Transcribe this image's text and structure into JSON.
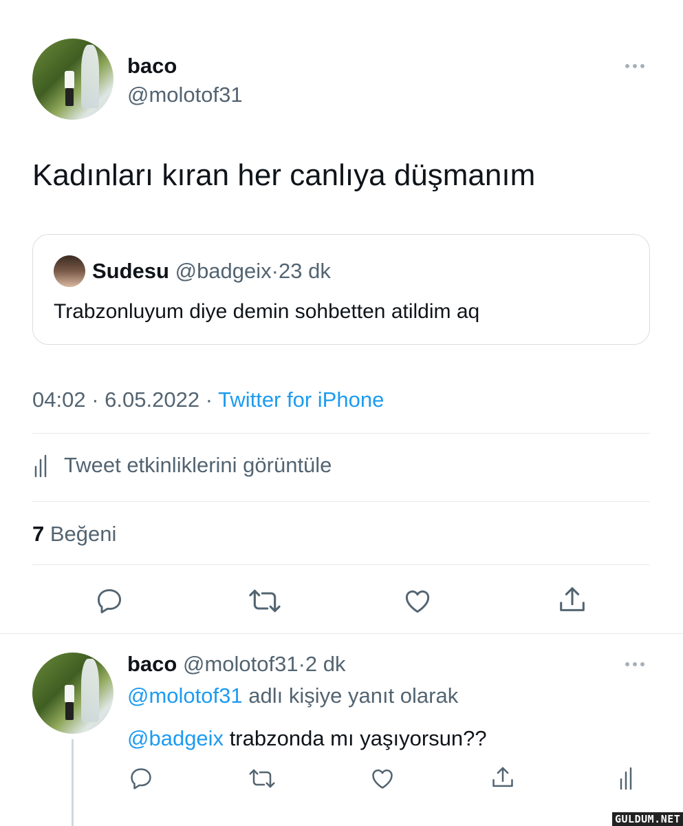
{
  "tweet": {
    "author_name": "baco",
    "author_handle": "@molotof31",
    "text": "Kadınları kıran her canlıya düşmanım",
    "quote": {
      "name": "Sudesu",
      "handle": "@badgeix",
      "separator": "·",
      "time": "23 dk",
      "text": "Trabzonluyum diye demin sohbetten atildim aq"
    },
    "meta": {
      "time": "04:02",
      "sep1": "·",
      "date": "6.05.2022",
      "sep2": "·",
      "source": "Twitter for iPhone"
    },
    "activity_label": "Tweet etkinliklerini görüntüle",
    "likes_count": "7",
    "likes_label": "Beğeni"
  },
  "reply": {
    "author_name": "baco",
    "author_handle": "@molotof31",
    "separator": "·",
    "time": "2 dk",
    "replying_to_handle": "@molotof31",
    "replying_to_suffix": "adlı kişiye yanıt olarak",
    "mention": "@badgeix",
    "text": "trabzonda mı yaşıyorsun??"
  },
  "watermark": "GULDUM.NET",
  "icons": [
    "reply-icon",
    "retweet-icon",
    "like-icon",
    "share-icon",
    "analytics-icon",
    "more-icon"
  ]
}
